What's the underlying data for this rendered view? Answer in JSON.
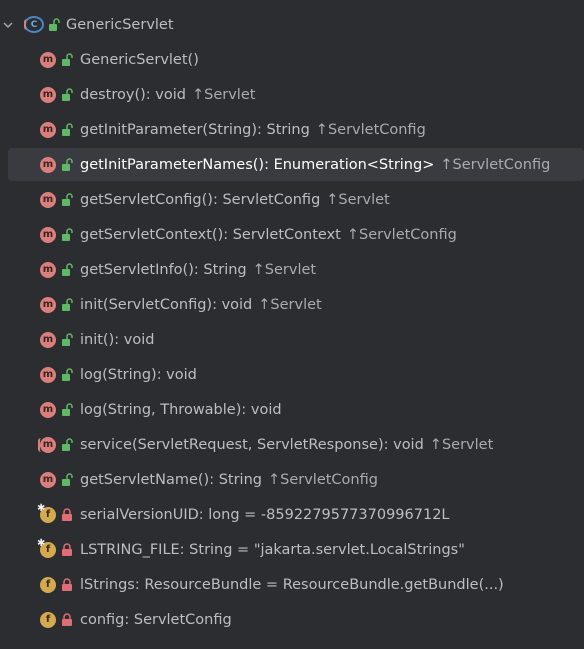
{
  "colors": {
    "background": "#2b2d30",
    "selection": "#393b40",
    "method_badge": "#d9807c",
    "field_badge": "#d5a94f",
    "class_badge": "#4b86c4",
    "public_lock": "#5fb865",
    "private_lock": "#e06c75"
  },
  "root": {
    "name": "GenericServlet",
    "expanded_icon": "chevron-down-icon",
    "type_icon": "abstract-class-icon",
    "badge_letter": "C"
  },
  "members": [
    {
      "kind": "m",
      "lock": "public",
      "name": "GenericServlet()",
      "origin": ""
    },
    {
      "kind": "m",
      "lock": "public",
      "name": "destroy(): void",
      "origin": "↑Servlet"
    },
    {
      "kind": "m",
      "lock": "public",
      "name": "getInitParameter(String): String",
      "origin": "↑ServletConfig"
    },
    {
      "kind": "m",
      "lock": "public",
      "name": "getInitParameterNames(): Enumeration<String>",
      "origin": "↑ServletConfig",
      "selected": true
    },
    {
      "kind": "m",
      "lock": "public",
      "name": "getServletConfig(): ServletConfig",
      "origin": "↑Servlet"
    },
    {
      "kind": "m",
      "lock": "public",
      "name": "getServletContext(): ServletContext",
      "origin": "↑ServletConfig"
    },
    {
      "kind": "m",
      "lock": "public",
      "name": "getServletInfo(): String",
      "origin": "↑Servlet"
    },
    {
      "kind": "m",
      "lock": "public",
      "name": "init(ServletConfig): void",
      "origin": "↑Servlet"
    },
    {
      "kind": "m",
      "lock": "public",
      "name": "init(): void",
      "origin": ""
    },
    {
      "kind": "m",
      "lock": "public",
      "name": "log(String): void",
      "origin": ""
    },
    {
      "kind": "m",
      "lock": "public",
      "name": "log(String, Throwable): void",
      "origin": ""
    },
    {
      "kind": "m-abstract",
      "lock": "public",
      "name": "service(ServletRequest, ServletResponse): void",
      "origin": "↑Servlet"
    },
    {
      "kind": "m",
      "lock": "public",
      "name": "getServletName(): String",
      "origin": "↑ServletConfig"
    },
    {
      "kind": "f-static",
      "lock": "private",
      "name": "serialVersionUID: long = -8592279577370996712L",
      "origin": ""
    },
    {
      "kind": "f-static",
      "lock": "private",
      "name": "LSTRING_FILE: String = \"jakarta.servlet.LocalStrings\"",
      "origin": ""
    },
    {
      "kind": "f",
      "lock": "private",
      "name": "lStrings: ResourceBundle = ResourceBundle.getBundle(...)",
      "origin": ""
    },
    {
      "kind": "f",
      "lock": "private",
      "name": "config: ServletConfig",
      "origin": ""
    }
  ]
}
